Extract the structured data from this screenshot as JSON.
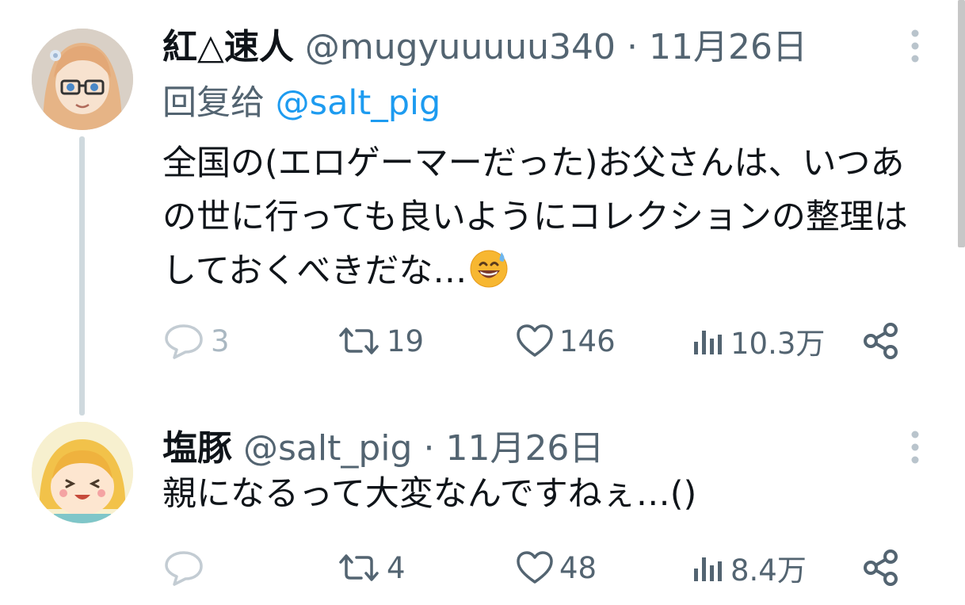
{
  "tweets": [
    {
      "display_name": "紅△速人",
      "handle": "@mugyuuuuu340",
      "separator": "·",
      "date": "11月26日",
      "reply_prefix": "回复给",
      "reply_handle": "@salt_pig",
      "text": "全国の(エロゲーマーだった)お父さんは、いつあの世に行っても良いようにコレクションの整理はしておくべきだな…",
      "emoji": "grinning-face-with-sweat-emoji",
      "stats": {
        "replies": "3",
        "retweets": "19",
        "likes": "146",
        "views": "10.3万"
      }
    },
    {
      "display_name": "塩豚",
      "handle": "@salt_pig",
      "separator": "·",
      "date": "11月26日",
      "text": "親になるって大変なんですねぇ…()",
      "stats": {
        "replies": "",
        "retweets": "4",
        "likes": "48",
        "views": "8.4万"
      }
    }
  ],
  "colors": {
    "text_primary": "#0f1419",
    "text_secondary": "#536471",
    "link": "#1d9bf0",
    "thread_line": "#cfd9de"
  }
}
